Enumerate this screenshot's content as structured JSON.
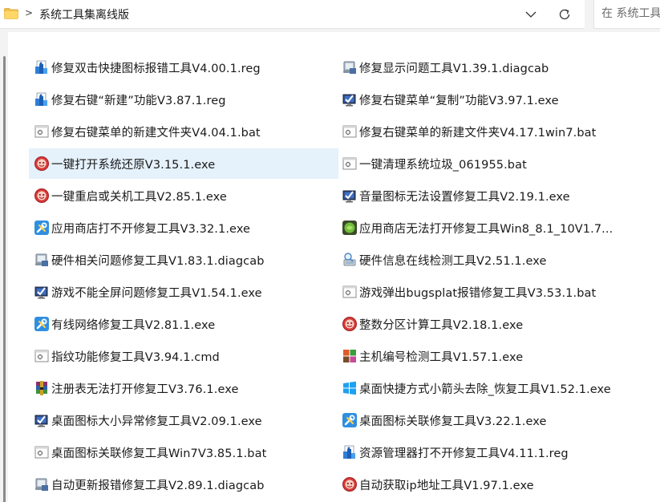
{
  "address_bar": {
    "breadcrumb_separator": ">",
    "path": "系统工具集离线版",
    "search_placeholder": "在 系统工具集离线版 中搜索"
  },
  "files": [
    {
      "name": "修复双击快捷图标报错工具V4.00.1.reg",
      "icon": "registry-script-icon"
    },
    {
      "name": "修复显示问题工具V1.39.1.diagcab",
      "icon": "diagnostic-package-icon"
    },
    {
      "name": "修复右键“新建”功能V3.87.1.reg",
      "icon": "registry-script-icon"
    },
    {
      "name": "修复右键菜单“复制”功能V3.97.1.exe",
      "icon": "monitor-check-icon"
    },
    {
      "name": "修复右键菜单的新建文件夹V4.04.1.bat",
      "icon": "batch-file-icon"
    },
    {
      "name": "修复右键菜单的新建文件夹V4.17.1win7.bat",
      "icon": "batch-file-icon"
    },
    {
      "name": "一键打开系统还原V3.15.1.exe",
      "icon": "red-badge-icon"
    },
    {
      "name": "一键清理系统垃圾_061955.bat",
      "icon": "batch-file-icon"
    },
    {
      "name": "一键重启或关机工具V2.85.1.exe",
      "icon": "red-badge-icon"
    },
    {
      "name": "音量图标无法设置修复工具V2.19.1.exe",
      "icon": "monitor-check-icon"
    },
    {
      "name": "应用商店打不开修复工具V3.32.1.exe",
      "icon": "tools-wrench-icon"
    },
    {
      "name": "应用商店无法打开修复工具Win8_8.1_10V1.7...",
      "icon": "green-app-icon"
    },
    {
      "name": "硬件相关问题修复工具V1.83.1.diagcab",
      "icon": "diagnostic-package-icon"
    },
    {
      "name": "硬件信息在线检测工具V2.51.1.exe",
      "icon": "hardware-scan-icon"
    },
    {
      "name": "游戏不能全屏问题修复工具V1.54.1.exe",
      "icon": "monitor-check-icon"
    },
    {
      "name": "游戏弹出bugsplat报错修复工具V3.53.1.bat",
      "icon": "batch-file-icon"
    },
    {
      "name": "有线网络修复工具V2.81.1.exe",
      "icon": "tools-wrench-icon"
    },
    {
      "name": "整数分区计算工具V2.18.1.exe",
      "icon": "red-badge-icon"
    },
    {
      "name": "指纹功能修复工具V3.94.1.cmd",
      "icon": "batch-file-icon"
    },
    {
      "name": "主机编号检测工具V1.57.1.exe",
      "icon": "colorful-grid-icon"
    },
    {
      "name": "注册表无法打开修复工V3.76.1.exe",
      "icon": "winrar-icon"
    },
    {
      "name": "桌面快捷方式小箭头去除_恢复工具V1.52.1.exe",
      "icon": "windows-logo-icon"
    },
    {
      "name": "桌面图标大小异常修复工具V2.09.1.exe",
      "icon": "monitor-check-icon"
    },
    {
      "name": "桌面图标关联修复工具V3.22.1.exe",
      "icon": "tools-wrench-icon"
    },
    {
      "name": "桌面图标关联修复工具Win7V3.85.1.bat",
      "icon": "batch-file-icon"
    },
    {
      "name": "资源管理器打不开修复工具V4.11.1.reg",
      "icon": "registry-script-icon"
    },
    {
      "name": "自动更新报错修复工具V2.89.1.diagcab",
      "icon": "diagnostic-package-icon"
    },
    {
      "name": "自动获取ip地址工具V1.97.1.exe",
      "icon": "red-badge-icon"
    }
  ],
  "selected_index": 6
}
